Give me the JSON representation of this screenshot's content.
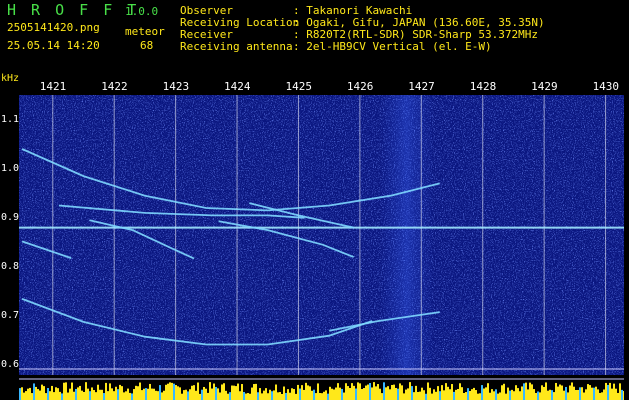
{
  "header": {
    "app_title": "H R O F F T",
    "version": "1.0.0",
    "filename": "2505141420.png",
    "datetime": "25.05.14 14:20",
    "detection_label": "meteor",
    "detection_count": "68",
    "info": [
      {
        "key": "Observer",
        "value": ": Takanori Kawachi"
      },
      {
        "key": "Receiving Location",
        "value": ": Ogaki, Gifu, JAPAN (136.60E, 35.35N)"
      },
      {
        "key": "Receiver",
        "value": ": R820T2(RTL-SDR) SDR-Sharp 53.372MHz"
      },
      {
        "key": "Receiving antenna",
        "value": ": 2el-HB9CV Vertical (el. E-W)"
      }
    ]
  },
  "colors": {
    "title": "#48e048",
    "label": "#ffe81a",
    "background": "#000000",
    "plot_background": "#0a1680",
    "trace": "#7fd8ff",
    "power_bar": "#ffe81a",
    "power_bar_alt": "#38b8ff"
  },
  "chart_data": {
    "type": "heatmap",
    "y_unit": "kHz",
    "yticks": [
      "1.1",
      "1.0",
      "0.9",
      "0.8",
      "0.7",
      "0.6"
    ],
    "xticks": [
      "1421",
      "1422",
      "1423",
      "1424",
      "1425",
      "1426",
      "1427",
      "1428",
      "1429",
      "1430"
    ],
    "ylim": [
      0.58,
      1.15
    ],
    "xlim": [
      1420.45,
      1430.3
    ],
    "carrier_khz": 0.88,
    "traces": [
      {
        "x": [
          1420.5,
          1421.5,
          1422.5,
          1423.5,
          1424.5,
          1425.5,
          1426.5,
          1427.3
        ],
        "y": [
          1.04,
          0.985,
          0.945,
          0.92,
          0.915,
          0.925,
          0.945,
          0.97
        ]
      },
      {
        "x": [
          1420.5,
          1421.5,
          1422.5,
          1423.5,
          1424.5,
          1425.5,
          1426.2
        ],
        "y": [
          0.735,
          0.688,
          0.658,
          0.642,
          0.642,
          0.66,
          0.69
        ]
      },
      {
        "x": [
          1425.5,
          1426.3,
          1427.3
        ],
        "y": [
          0.67,
          0.69,
          0.708
        ]
      },
      {
        "x": [
          1420.5,
          1421.3
        ],
        "y": [
          0.852,
          0.818
        ]
      },
      {
        "x": [
          1421.6,
          1422.3,
          1422.9,
          1423.3
        ],
        "y": [
          0.895,
          0.875,
          0.84,
          0.817
        ]
      },
      {
        "x": [
          1423.7,
          1424.5,
          1425.4,
          1425.9
        ],
        "y": [
          0.893,
          0.875,
          0.845,
          0.82
        ]
      },
      {
        "x": [
          1424.2,
          1425.0,
          1425.9
        ],
        "y": [
          0.93,
          0.905,
          0.88
        ]
      },
      {
        "x": [
          1421.1,
          1422.5,
          1423.6,
          1424.5,
          1425.1
        ],
        "y": [
          0.925,
          0.91,
          0.905,
          0.905,
          0.9
        ]
      }
    ]
  }
}
